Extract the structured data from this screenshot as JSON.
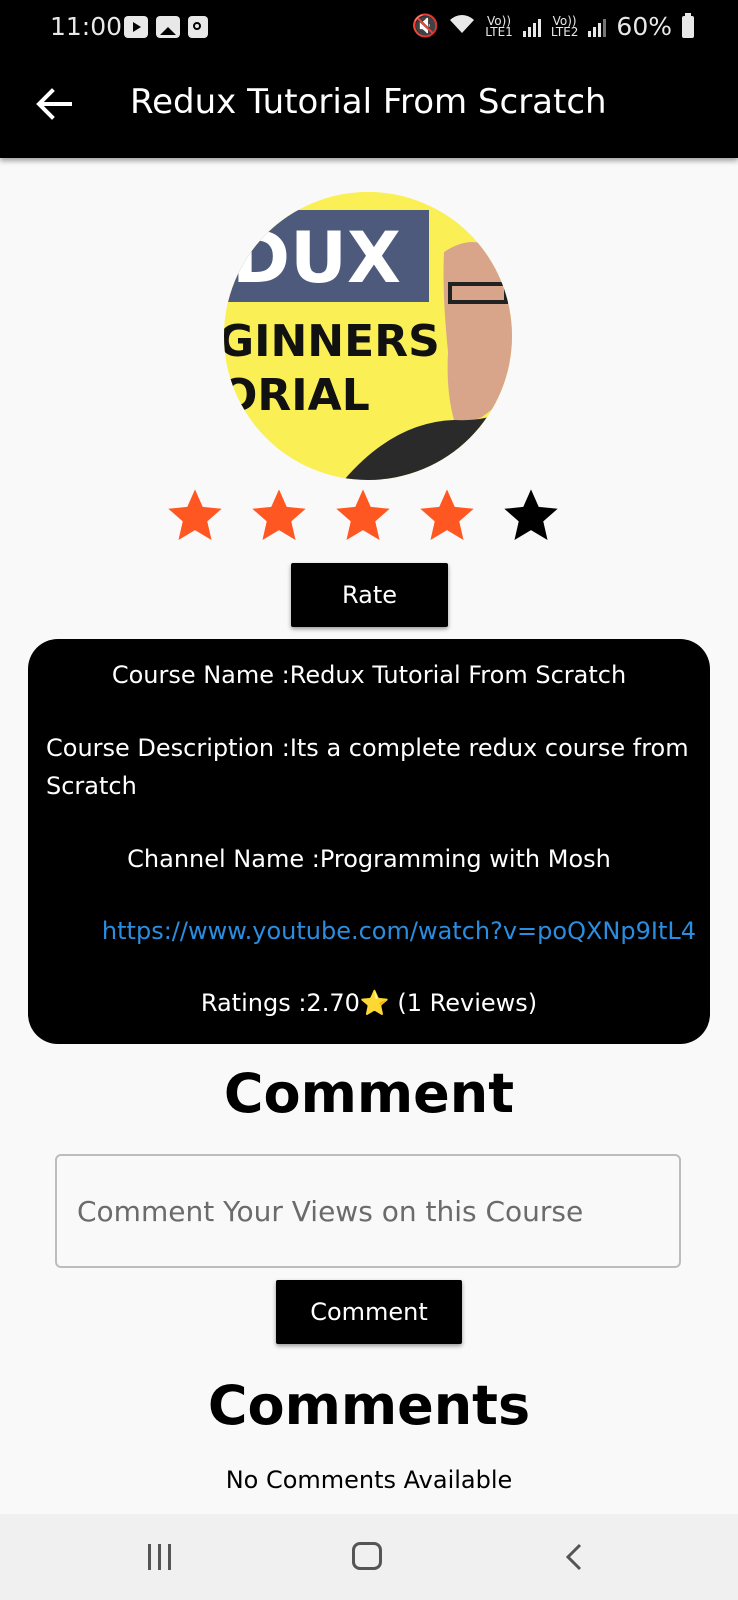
{
  "status_bar": {
    "time": "11:00",
    "sim1": "Vo))\nLTE1",
    "sim2": "Vo))\nLTE2",
    "battery": "60%"
  },
  "app_bar": {
    "title": "Redux Tutorial From Scratch"
  },
  "thumbnail": {
    "line1": "DUX",
    "line2": "GINNERS",
    "line3": "ORIAL"
  },
  "rating_widget": {
    "stars_total": 5,
    "stars_filled": 4,
    "filled_color": "#ff5722",
    "empty_color": "#000000"
  },
  "rate_button": "Rate",
  "course_info": {
    "name_line": "Course Name :Redux Tutorial From Scratch",
    "description_line": "Course Description :Its a complete redux course from Scratch",
    "channel_line": "Channel Name :Programming with Mosh",
    "url": "https://www.youtube.com/watch?v=poQXNp9ItL4",
    "ratings_prefix": "Ratings :2.70",
    "ratings_star": "⭐",
    "ratings_suffix": " (1 Reviews)"
  },
  "comment_section": {
    "heading": "Comment",
    "input_placeholder": "Comment Your Views on this Course",
    "input_value": "",
    "submit_label": "Comment"
  },
  "comments_list": {
    "heading": "Comments",
    "empty_text": "No Comments Available"
  },
  "colors": {
    "app_bar": "#000000",
    "link": "#2b8de0",
    "star_filled": "#ff5722"
  }
}
